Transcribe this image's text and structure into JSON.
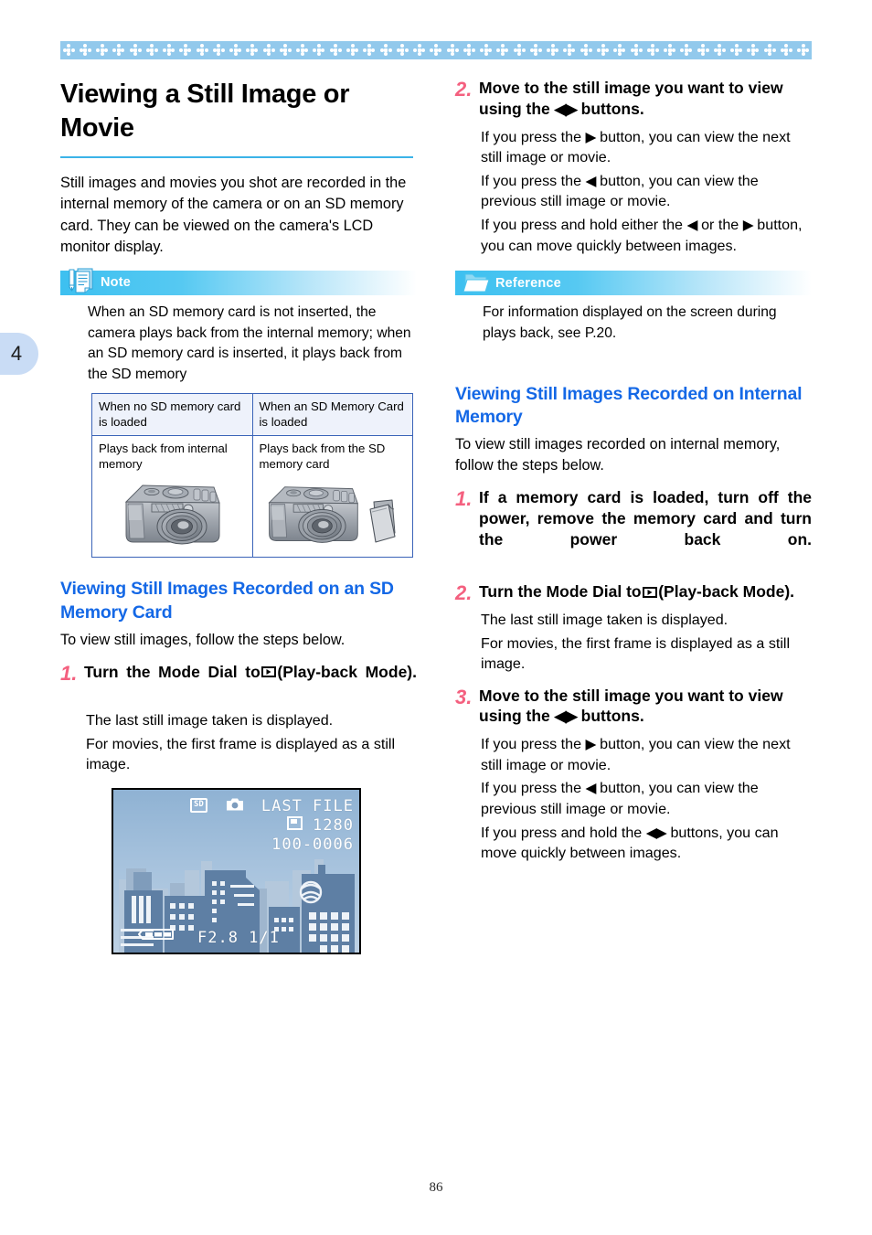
{
  "page": {
    "number": "86",
    "chapter_tab": "4",
    "accent_blue": "#1468e6",
    "rule_blue": "#3bb3e8",
    "step_number_color": "#f4607f",
    "band_blue": "#92c9ec"
  },
  "left_column": {
    "title": "Viewing a Still Image or Movie",
    "intro": "Still images and movies you shot are recorded in the internal memory of the camera or on an SD memory card. They can be viewed on the camera's LCD monitor display.",
    "note_box": {
      "label": "Note",
      "icon": "note-pencil-document-icon",
      "text": "When an SD memory card is not inserted, the camera plays back from the internal memory; when an SD memory card is inserted, it plays back from the SD memory",
      "table": {
        "headers": [
          "When no SD memory card is loaded",
          "When an SD Memory Card is loaded"
        ],
        "rows": [
          [
            "Plays back from internal memory",
            "Plays back from the SD memory card"
          ]
        ],
        "illustrations": [
          "camera-illustration",
          "camera-and-sd-card-illustration"
        ]
      }
    },
    "section": {
      "title": "Viewing Still Images Recorded on an SD Memory Card",
      "intro": "To view still images, follow the steps below."
    },
    "steps": [
      {
        "number": "1.",
        "title_before": "Turn the Mode Dial to",
        "title_after": "(Play-back Mode).",
        "icon": "playback-mode-dial-icon",
        "details": [
          "The last still image taken is displayed.",
          "For movies, the first frame is displayed as a still image."
        ]
      }
    ],
    "lcd_figure": {
      "name": "lcd-playback-screenshot",
      "sd_badge": "SD",
      "camera_icon": "still-image-camera-icon",
      "last_file": "LAST FILE",
      "resolution": "1280",
      "file_number": "100-0006",
      "exif": "F2.8 1/1",
      "battery_icon": "battery-full-icon",
      "scene": "city skyline"
    }
  },
  "right_column": {
    "steps_top": [
      {
        "number": "2.",
        "title_before": "Move to the still image you want to view using the",
        "title_after": "buttons.",
        "icon": "left-right-arrow-buttons-icon",
        "details": [
          {
            "pre": "If you press the",
            "glyph": "right-arrow-icon",
            "post": "button, you can view the next still image or movie."
          },
          {
            "pre": "If you press the",
            "glyph": "left-arrow-icon",
            "post": "button, you can view the previous still image or movie."
          },
          {
            "pre": "If you press and hold either the",
            "glyph": "left-arrow-icon",
            "mid": "or the",
            "glyph2": "right-arrow-icon",
            "post": "button, you can move quickly between images."
          }
        ]
      }
    ],
    "reference_box": {
      "label": "Reference",
      "icon": "reference-folder-icon",
      "text": "For information displayed on the screen during plays back, see P.20."
    },
    "section": {
      "title": "Viewing Still Images Recorded on Internal Memory",
      "intro": "To view  still images recorded on internal memory, follow the steps below."
    },
    "steps": [
      {
        "number": "1.",
        "title": "If a memory card is loaded, turn off the power, remove the memory card and turn the power back on.",
        "details": []
      },
      {
        "number": "2.",
        "title_before": "Turn the Mode Dial to",
        "title_after": "(Play-back Mode).",
        "icon": "playback-mode-dial-icon",
        "details": [
          "The last still image taken is displayed.",
          "For movies, the first frame is displayed as a still image."
        ]
      },
      {
        "number": "3.",
        "title_before": "Move to the still image you want to view using the",
        "title_after": "buttons.",
        "icon": "left-right-arrow-buttons-icon",
        "details": [
          {
            "pre": "If you press the",
            "glyph": "right-arrow-icon",
            "post": "button, you can view the next still image or movie."
          },
          {
            "pre": "If you press the",
            "glyph": "left-arrow-icon",
            "post": "button, you can view the previous still image or movie."
          },
          {
            "pre": "If you press and hold the",
            "glyph": "left-right-arrow-buttons-icon",
            "post": "buttons, you can move quickly between images."
          }
        ]
      }
    ]
  }
}
